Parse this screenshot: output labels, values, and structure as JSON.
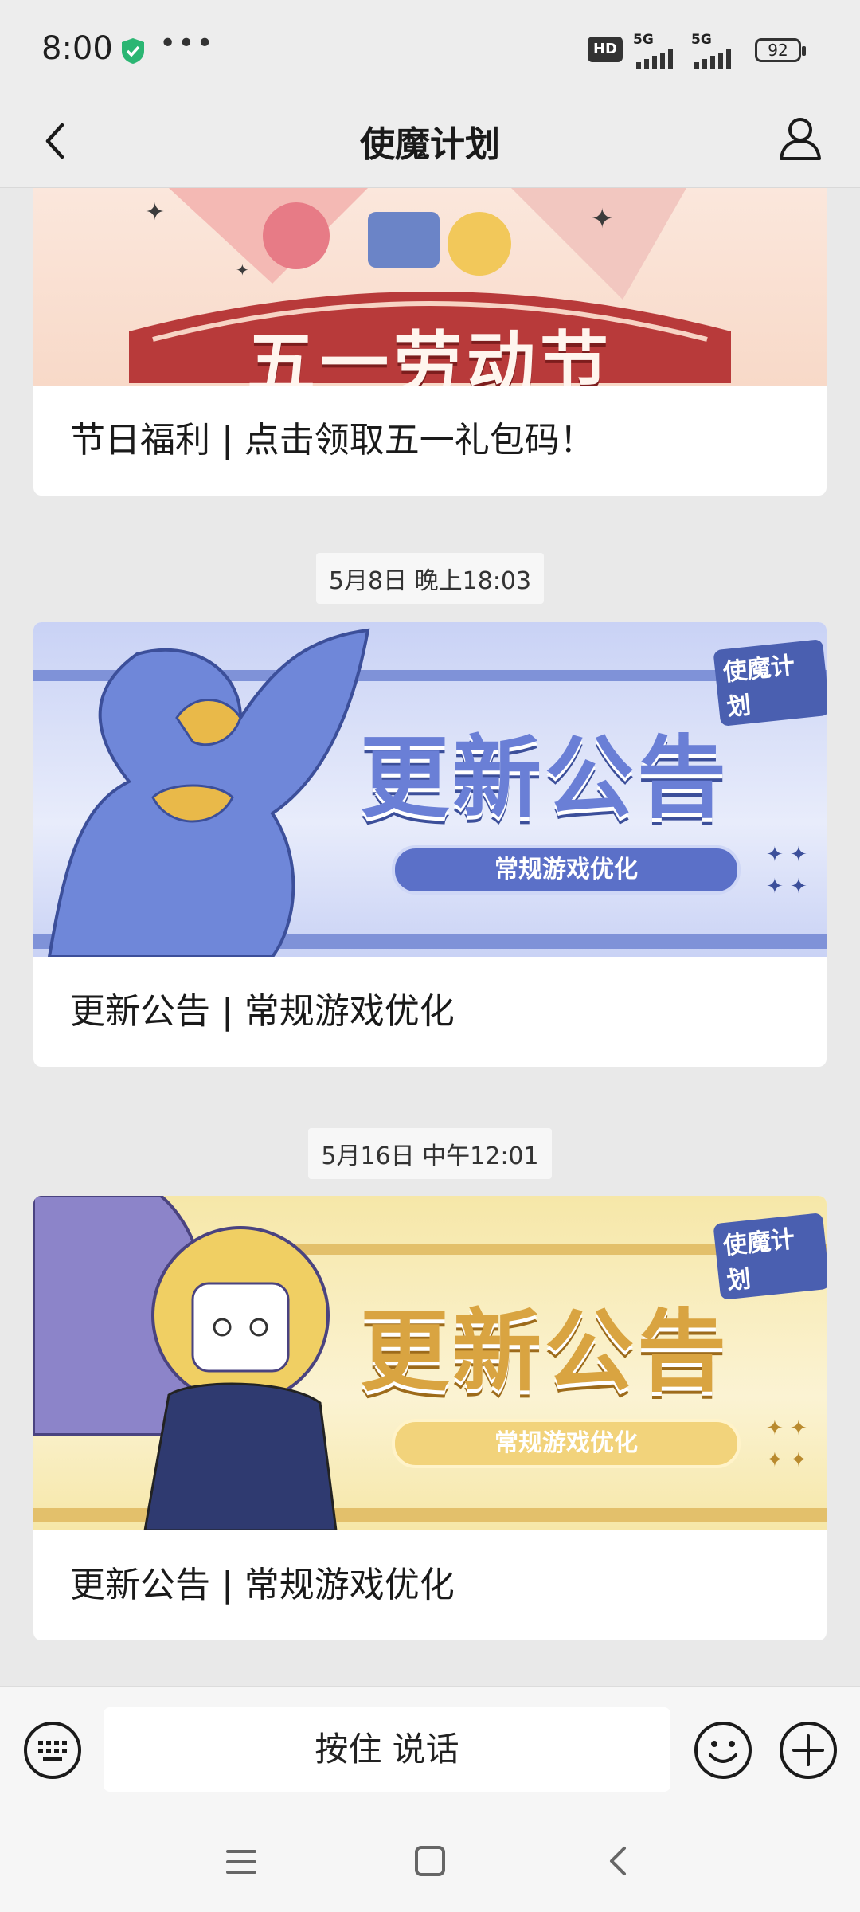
{
  "status_bar": {
    "time": "8:00",
    "dots": "•••",
    "hd_label": "HD",
    "network_1": "5G",
    "network_2": "5G",
    "battery": "92"
  },
  "nav": {
    "title": "使魔计划"
  },
  "feed": {
    "cards": [
      {
        "banner_text": "五一劳动节",
        "title": "节日福利 | 点击领取五一礼包码！"
      },
      {
        "timestamp": "5月8日 晚上18:03",
        "banner_logo": "使魔计划",
        "banner_heading": "更新公告",
        "banner_sub": "常规游戏优化",
        "title": "更新公告 | 常规游戏优化"
      },
      {
        "timestamp": "5月16日 中午12:01",
        "banner_logo": "使魔计划",
        "banner_heading": "更新公告",
        "banner_sub": "常规游戏优化",
        "title": "更新公告 | 常规游戏优化"
      }
    ]
  },
  "input_bar": {
    "voice_label": "按住 说话"
  },
  "colors": {
    "blue_banner": "#8fa2e6",
    "gold_banner": "#f3e4a6",
    "red_banner": "#b83a3a"
  }
}
